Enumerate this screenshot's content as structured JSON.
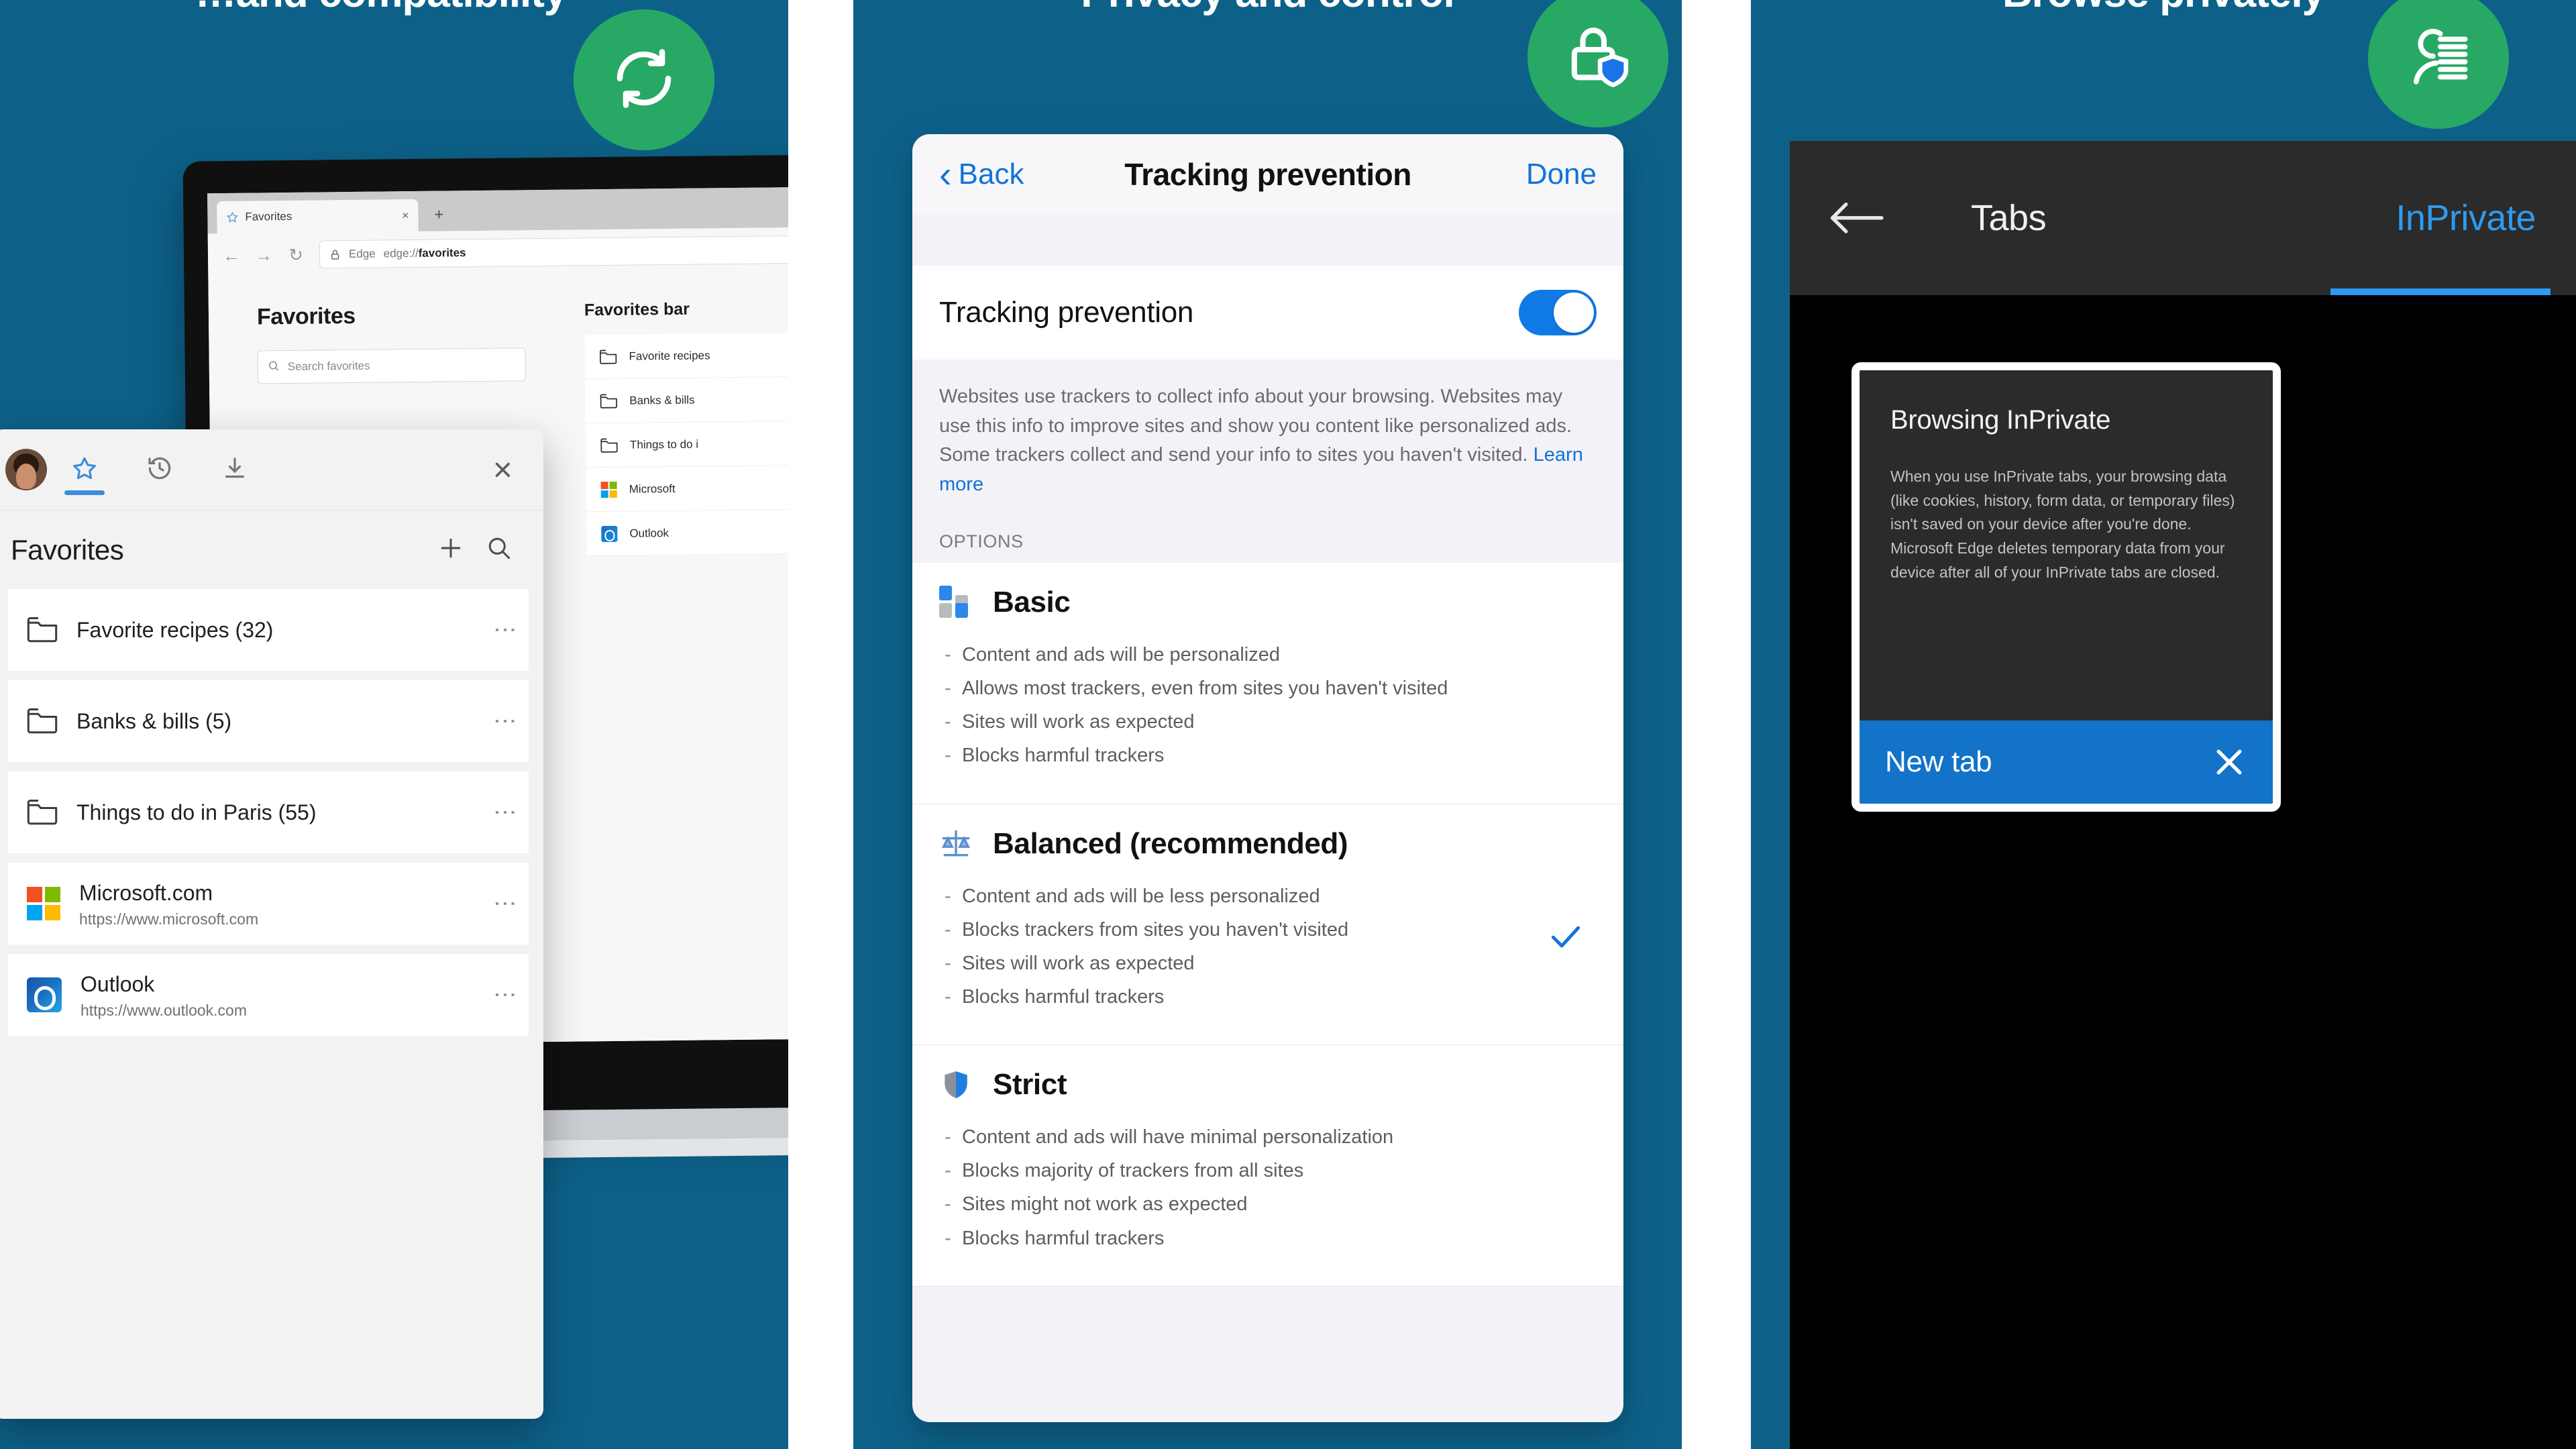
{
  "panels": [
    {
      "title": "…and compatibility",
      "badge_icon": "sync-icon",
      "browser": {
        "tab_label": "Favorites",
        "tab_close": "×",
        "new_tab": "+",
        "address_prefix": "Edge",
        "address_value": "edge://favorites",
        "address_bold": "favorites",
        "page_heading": "Favorites",
        "search_placeholder": "Search favorites",
        "bar_heading": "Favorites bar",
        "bar_items": [
          {
            "label": "Favorite recipes",
            "icon": "folder-icon"
          },
          {
            "label": "Banks & bills",
            "icon": "folder-icon"
          },
          {
            "label": "Things to do i",
            "icon": "folder-icon"
          },
          {
            "label": "Microsoft",
            "icon": "microsoft-logo-icon"
          },
          {
            "label": "Outlook",
            "icon": "outlook-logo-icon"
          }
        ]
      },
      "flyout": {
        "avatar": "profile-avatar",
        "tabs": [
          {
            "icon": "star-icon",
            "name": "favorites",
            "active": true
          },
          {
            "icon": "history-icon",
            "name": "history",
            "active": false
          },
          {
            "icon": "downloads-icon",
            "name": "downloads",
            "active": false
          }
        ],
        "close_label": "×",
        "heading": "Favorites",
        "add_icon": "plus-icon",
        "search_icon": "search-icon",
        "more_glyph": "⋮",
        "items": [
          {
            "type": "folder",
            "title": "Favorite recipes (32)",
            "sub": ""
          },
          {
            "type": "folder",
            "title": "Banks & bills (5)",
            "sub": ""
          },
          {
            "type": "folder",
            "title": "Things to do in Paris (55)",
            "sub": ""
          },
          {
            "type": "microsoft",
            "title": "Microsoft.com",
            "sub": "https://www.microsoft.com"
          },
          {
            "type": "outlook",
            "title": "Outlook",
            "sub": "https://www.outlook.com"
          }
        ]
      }
    },
    {
      "title": "Privacy and control",
      "badge_icon": "lock-shield-icon",
      "nav": {
        "back_label": "Back",
        "back_chevron": "‹",
        "title": "Tracking prevention",
        "done_label": "Done"
      },
      "toggle_row": {
        "label": "Tracking prevention",
        "state": "on"
      },
      "description": "Websites use trackers to collect info about your browsing. Websites may use this info to improve sites and show you content like personalized ads. Some trackers collect and send your info to sites you haven't visited.",
      "learn_more": "Learn more",
      "options_header": "OPTIONS",
      "options": [
        {
          "name": "Basic",
          "icon": "basic-blocks-icon",
          "selected": false,
          "bullets": [
            "Content and ads will be personalized",
            "Allows most trackers, even from sites you haven't visited",
            "Sites will work as expected",
            "Blocks harmful trackers"
          ]
        },
        {
          "name": "Balanced (recommended)",
          "icon": "balance-scale-icon",
          "selected": true,
          "bullets": [
            "Content and ads will be less personalized",
            "Blocks trackers from sites you haven't visited",
            "Sites will work as expected",
            "Blocks harmful trackers"
          ]
        },
        {
          "name": "Strict",
          "icon": "shield-icon",
          "selected": false,
          "bullets": [
            "Content and ads will have minimal personalization",
            "Blocks majority of trackers from all sites",
            "Sites might not work as expected",
            "Blocks harmful trackers"
          ]
        }
      ]
    },
    {
      "title": "Browse privately",
      "badge_icon": "inprivate-person-icon",
      "nav": {
        "back_icon": "arrow-left-icon",
        "tabs_label": "Tabs",
        "inprivate_label": "InPrivate",
        "selected": "InPrivate"
      },
      "card": {
        "heading": "Browsing InPrivate",
        "body": "When you use InPrivate tabs, your browsing data (like cookies, history, form data, or temporary files) isn't saved on your device after you're done. Microsoft Edge deletes temporary data from your device after all of your InPrivate tabs are closed.",
        "tab_label": "New tab",
        "close_icon": "close-icon"
      }
    }
  ],
  "colors": {
    "panel_bg": "#0d6189",
    "badge_green": "#28a865",
    "accent_blue": "#1273d6",
    "ios_toggle": "#0f7ae5",
    "inprivate_blue": "#2e9bf0",
    "newtab_blue": "#1273c8"
  }
}
